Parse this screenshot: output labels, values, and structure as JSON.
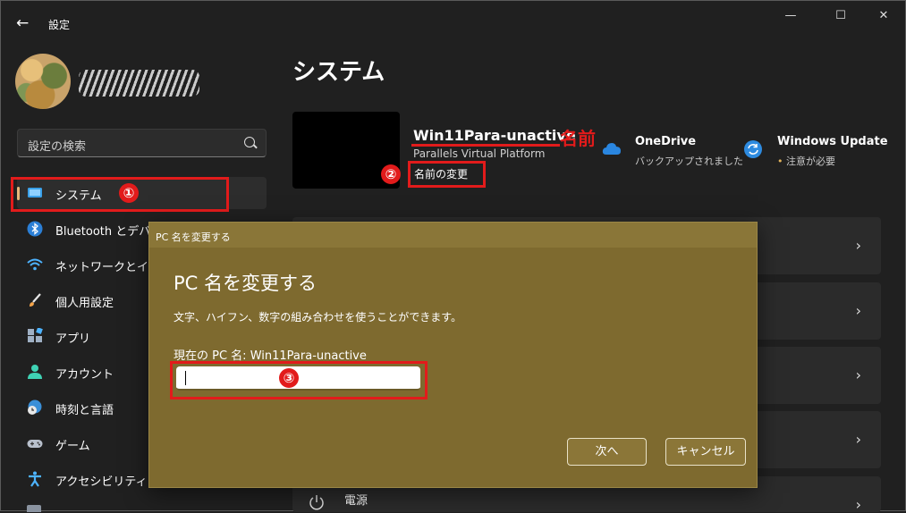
{
  "window": {
    "title": "設定",
    "back_icon": "arrow-left-icon",
    "controls": {
      "minimize": "—",
      "maximize": "☐",
      "close": "✕"
    }
  },
  "account": {
    "avatar": "user-avatar",
    "name_obscured": true
  },
  "search": {
    "placeholder": "設定の検索",
    "icon": "search-icon"
  },
  "nav": {
    "items": [
      {
        "label": "システム",
        "icon": "monitor-icon",
        "selected": true
      },
      {
        "label": "Bluetooth とデバイス",
        "icon": "bluetooth-icon"
      },
      {
        "label": "ネットワークとインターネット",
        "icon": "wifi-icon"
      },
      {
        "label": "個人用設定",
        "icon": "brush-icon"
      },
      {
        "label": "アプリ",
        "icon": "apps-icon"
      },
      {
        "label": "アカウント",
        "icon": "person-icon"
      },
      {
        "label": "時刻と言語",
        "icon": "globe-clock-icon"
      },
      {
        "label": "ゲーム",
        "icon": "gamepad-icon"
      },
      {
        "label": "アクセシビリティ",
        "icon": "accessibility-icon"
      }
    ]
  },
  "main": {
    "title": "システム",
    "device": {
      "name": "Win11Para-unactive",
      "model": "Parallels Virtual Platform",
      "rename_label": "名前の変更"
    },
    "onedrive": {
      "title": "OneDrive",
      "status": "バックアップされました",
      "icon": "onedrive-cloud-icon"
    },
    "windows_update": {
      "title": "Windows Update",
      "status": "注意が必要",
      "icon": "sync-icon"
    },
    "power": {
      "label": "電源",
      "icon": "power-icon"
    }
  },
  "annotations": {
    "step1": "①",
    "step2": "②",
    "step3": "③",
    "name_label": "名前",
    "color": "#e21b1b"
  },
  "dialog": {
    "caption": "PC 名を変更する",
    "title": "PC 名を変更する",
    "description": "文字、ハイフン、数字の組み合わせを使うことができます。",
    "current_name": "現在の PC 名: Win11Para-unactive",
    "input_value": "",
    "next_label": "次へ",
    "cancel_label": "キャンセル",
    "background": "#7e6a2f"
  }
}
